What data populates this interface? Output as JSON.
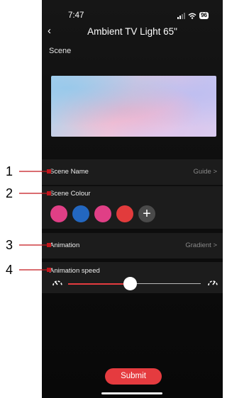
{
  "status_bar": {
    "time": "7:47",
    "battery": "96"
  },
  "header": {
    "title": "Ambient TV Light 65\"",
    "back_icon": "chevron-left-icon"
  },
  "scene": {
    "label": "Scene"
  },
  "scene_name": {
    "label": "Scene Name",
    "value": "Guide",
    "chevron": ">"
  },
  "scene_colour": {
    "label": "Scene Colour",
    "colors": [
      "#e03f86",
      "#2367c0",
      "#e03f86",
      "#e23b3c"
    ],
    "add_label": "+"
  },
  "animation": {
    "label": "Animation",
    "value": "Gradient",
    "chevron": ">"
  },
  "animation_speed": {
    "label": "Animation speed",
    "level_fraction": 0.47
  },
  "submit": {
    "label": "Submit"
  },
  "annotations": {
    "n1": "1",
    "n2": "2",
    "n3": "3",
    "n4": "4"
  },
  "accent_color": "#e53b3f"
}
